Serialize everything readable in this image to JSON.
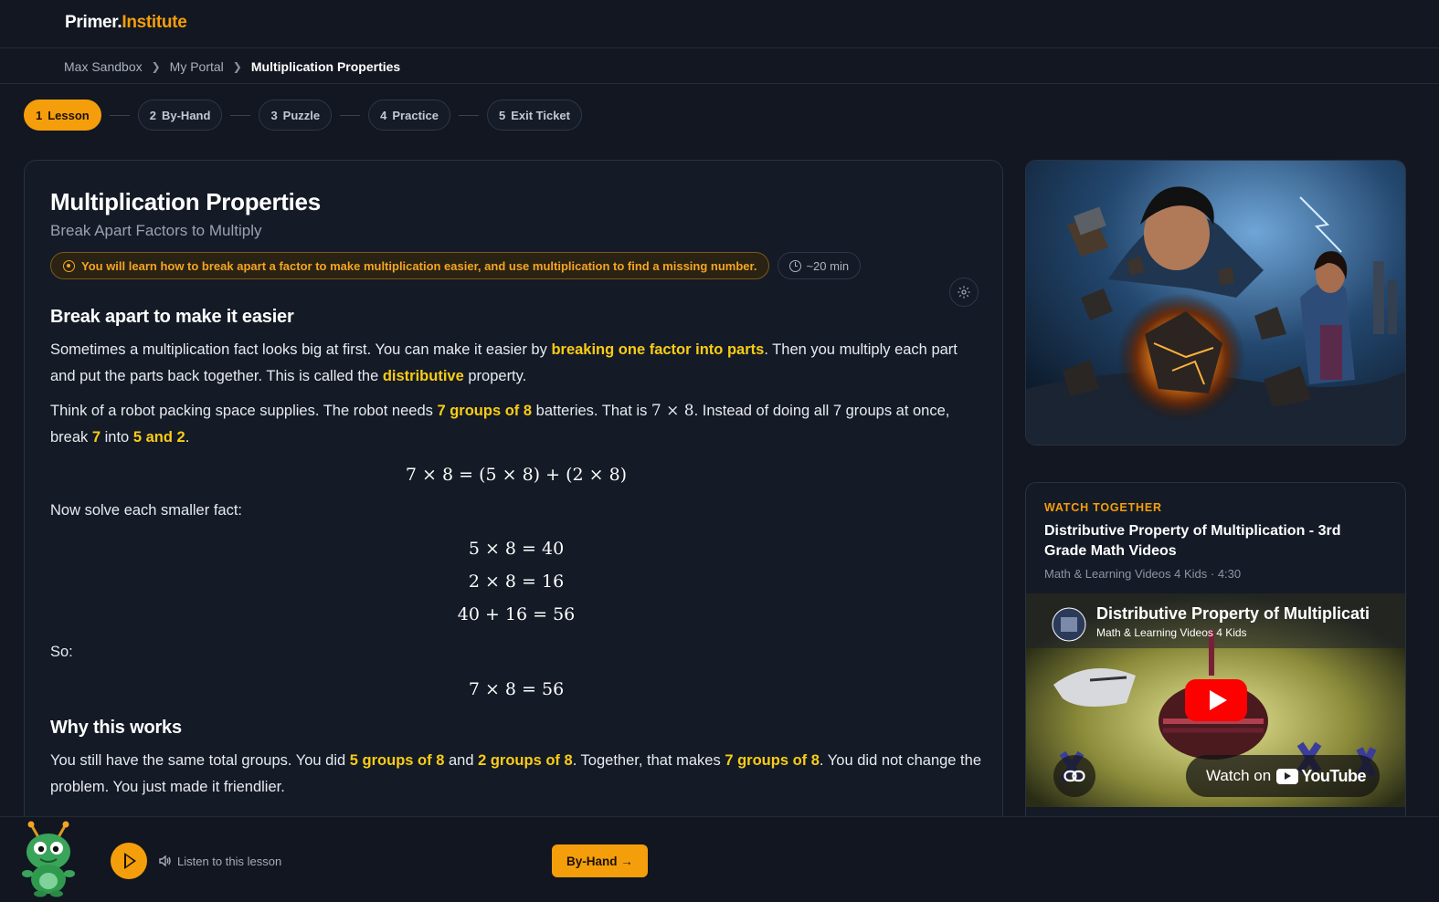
{
  "brand": {
    "part1": "Primer.",
    "part2": "Institute"
  },
  "breadcrumb": [
    "Max Sandbox",
    "My Portal",
    "Multiplication Properties"
  ],
  "steps": [
    {
      "num": "1",
      "label": "Lesson",
      "active": true
    },
    {
      "num": "2",
      "label": "By-Hand",
      "active": false
    },
    {
      "num": "3",
      "label": "Puzzle",
      "active": false
    },
    {
      "num": "4",
      "label": "Practice",
      "active": false
    },
    {
      "num": "5",
      "label": "Exit Ticket",
      "active": false
    }
  ],
  "lesson": {
    "title": "Multiplication Properties",
    "subtitle": "Break Apart Factors to Multiply",
    "goal": "You will learn how to break apart a factor to make multiplication easier, and use multiplication to find a missing number.",
    "time": "~20 min",
    "section1": {
      "heading": "Break apart to make it easier",
      "p1": [
        "Sometimes a multiplication fact looks big at first. You can make it easier by ",
        "breaking one factor into parts",
        ". Then you multiply each part and put the parts back together. This is called the ",
        "distributive",
        " property."
      ],
      "p2": [
        "Think of a robot packing space supplies. The robot needs ",
        "7 groups of 8",
        " batteries. That is ",
        "7 × 8",
        ". Instead of doing all 7 groups at once, break ",
        "7",
        " into ",
        "5 and 2",
        "."
      ],
      "eq1": "7 × 8 = (5 × 8) + (2 × 8)",
      "p3": "Now solve each smaller fact:",
      "eq2": "5 × 8 = 40",
      "eq3": "2 × 8 = 16",
      "eq4": "40 + 16 = 56",
      "p4": "So:",
      "eq5": "7 × 8 = 56"
    },
    "section2": {
      "heading": "Why this works",
      "p1": [
        "You still have the same total groups. You did ",
        "5 groups of 8",
        " and ",
        "2 groups of 8",
        ". Together, that makes ",
        "7 groups of 8",
        ". You did not change the problem. You just made it friendlier."
      ]
    }
  },
  "video": {
    "kicker": "WATCH TOGETHER",
    "title": "Distributive Property of Multiplication - 3rd Grade Math Videos",
    "meta": "Math & Learning Videos 4 Kids · 4:30",
    "thumb_title": "Distributive Property of Multiplicati",
    "thumb_channel": "Math & Learning Videos 4 Kids",
    "watch_on": "Watch on",
    "youtube": "YouTube"
  },
  "footer": {
    "listen": "Listen to this lesson",
    "next": "By-Hand →"
  },
  "colors": {
    "accent": "#f59e0b",
    "highlight": "#facc15",
    "bg": "#121722"
  }
}
